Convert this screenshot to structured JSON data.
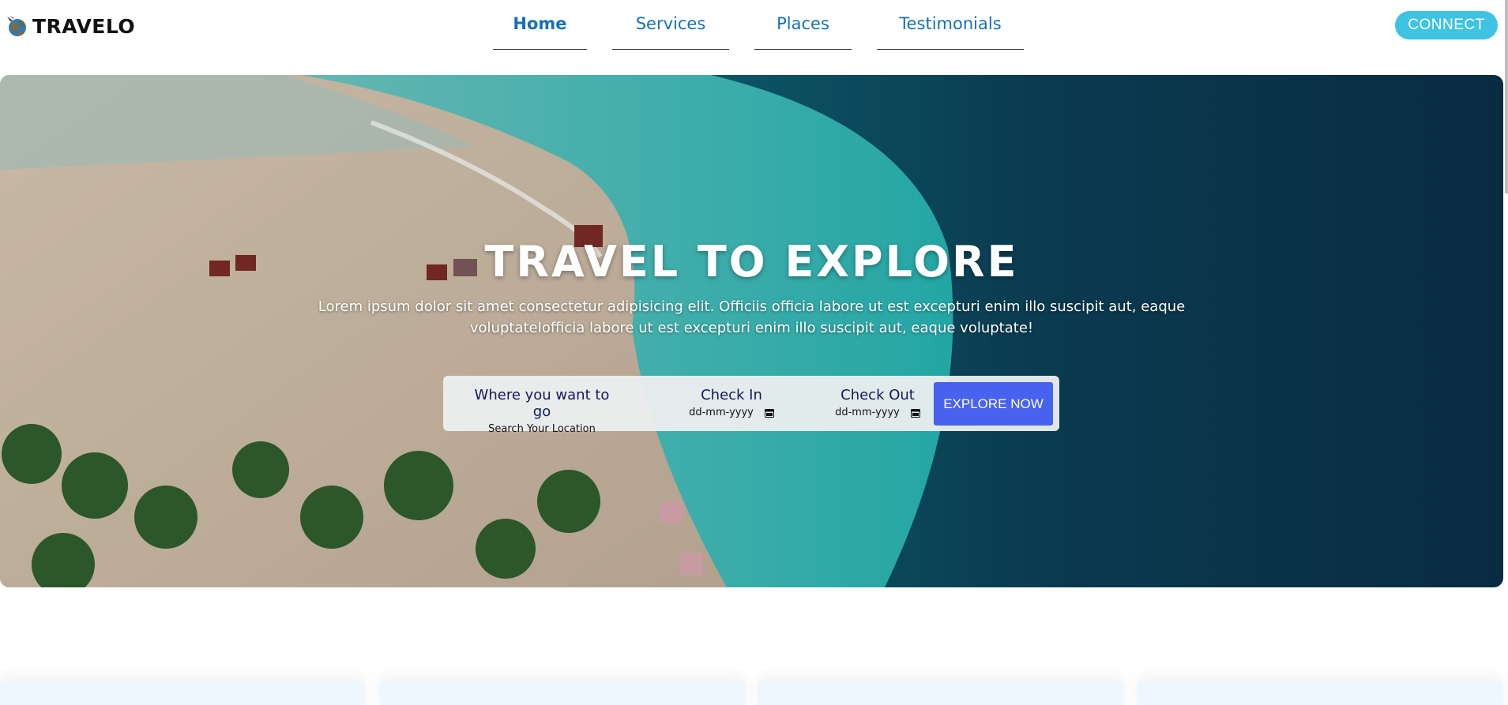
{
  "brand": {
    "name": "TRAVELO",
    "icon": "globe-plane-icon"
  },
  "nav": {
    "items": [
      {
        "label": "Home",
        "active": true
      },
      {
        "label": "Services",
        "active": false
      },
      {
        "label": "Places",
        "active": false
      },
      {
        "label": "Testimonials",
        "active": false
      }
    ]
  },
  "connect_label": "CONNECT",
  "hero": {
    "title": "TRAVEL TO EXPLORE",
    "subtitle": "Lorem ipsum dolor sit amet consectetur adipisicing elit. Officiis officia labore ut est excepturi enim illo suscipit aut, eaque voluptateIofficia labore ut est excepturi enim illo suscipit aut, eaque voluptate!"
  },
  "search": {
    "where_label": "Where you want to go",
    "where_placeholder": "Search Your Location",
    "checkin_label": "Check In",
    "checkin_value": "dd-mm-yyyy",
    "checkout_label": "Check Out",
    "checkout_value": "dd-mm-yyyy",
    "explore_label": "EXPLORE NOW"
  },
  "colors": {
    "nav_text": "#1670b7",
    "connect_bg": "#3fc3e2",
    "explore_bg": "#4862f0",
    "field_label": "#14195c"
  }
}
